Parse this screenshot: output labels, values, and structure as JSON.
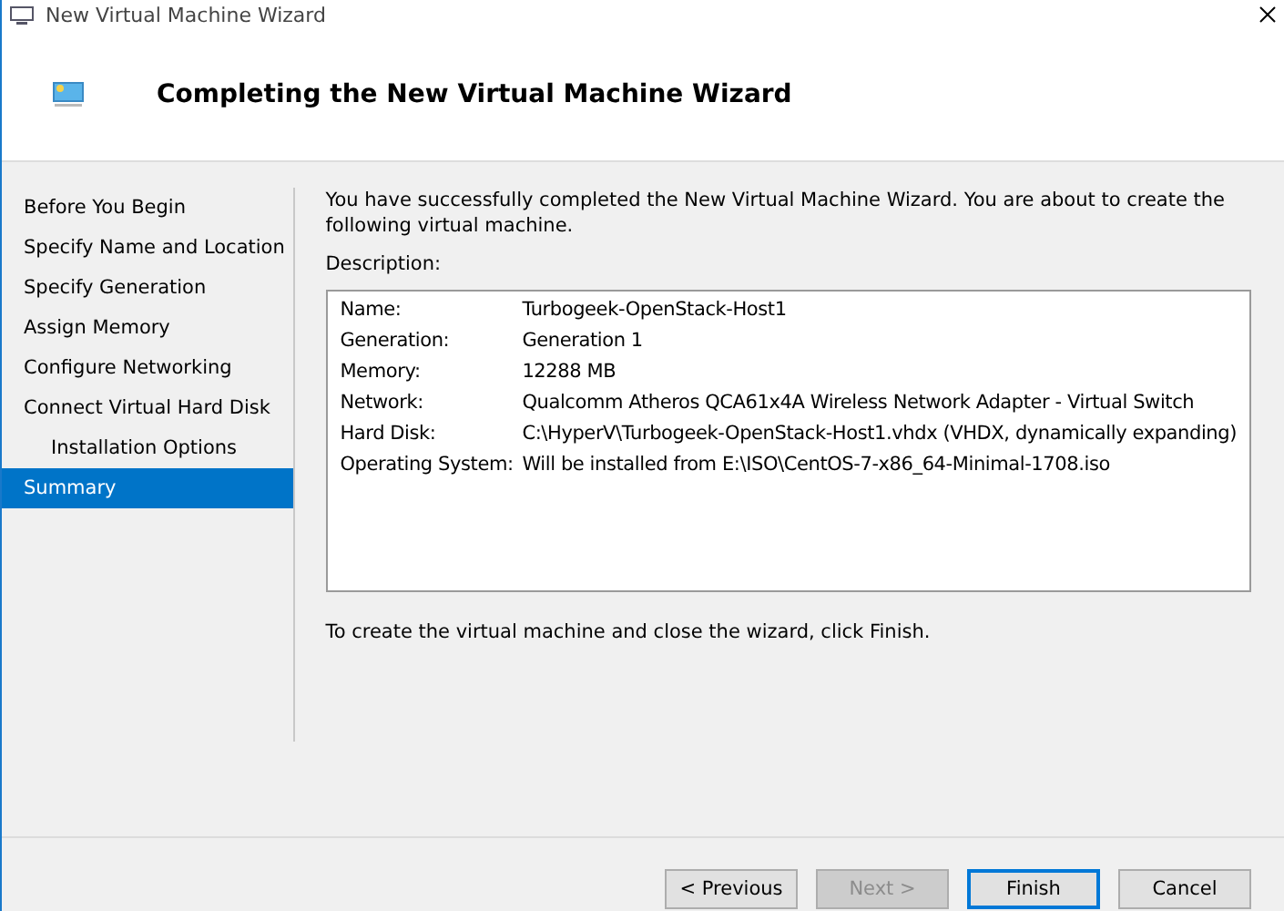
{
  "window": {
    "title": "New Virtual Machine Wizard"
  },
  "header": {
    "title": "Completing the New Virtual Machine Wizard"
  },
  "sidebar": {
    "items": [
      {
        "label": "Before You Begin",
        "selected": false
      },
      {
        "label": "Specify Name and Location",
        "selected": false
      },
      {
        "label": "Specify Generation",
        "selected": false
      },
      {
        "label": "Assign Memory",
        "selected": false
      },
      {
        "label": "Configure Networking",
        "selected": false
      },
      {
        "label": "Connect Virtual Hard Disk",
        "selected": false,
        "children": [
          {
            "label": "Installation Options",
            "selected": false
          }
        ]
      },
      {
        "label": "Summary",
        "selected": true
      }
    ]
  },
  "content": {
    "intro": "You have successfully completed the New Virtual Machine Wizard. You are about to create the following virtual machine.",
    "description_label": "Description:",
    "description": [
      {
        "key": "Name:",
        "value": "Turbogeek-OpenStack-Host1"
      },
      {
        "key": "Generation:",
        "value": "Generation 1"
      },
      {
        "key": "Memory:",
        "value": "12288 MB"
      },
      {
        "key": "Network:",
        "value": "Qualcomm Atheros QCA61x4A Wireless Network Adapter - Virtual Switch"
      },
      {
        "key": "Hard Disk:",
        "value": "C:\\HyperV\\Turbogeek-OpenStack-Host1.vhdx (VHDX, dynamically expanding)"
      },
      {
        "key": "Operating System:",
        "value": "Will be installed from E:\\ISO\\CentOS-7-x86_64-Minimal-1708.iso"
      }
    ],
    "footer_note": "To create the virtual machine and close the wizard, click Finish."
  },
  "buttons": [
    {
      "label": "< Previous",
      "disabled": false,
      "default": false
    },
    {
      "label": "Next >",
      "disabled": true,
      "default": false
    },
    {
      "label": "Finish",
      "disabled": false,
      "default": true
    },
    {
      "label": "Cancel",
      "disabled": false,
      "default": false
    }
  ]
}
